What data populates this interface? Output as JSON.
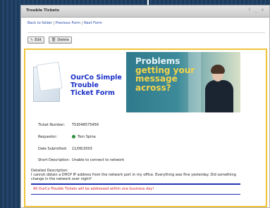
{
  "window": {
    "title": "Trouble Tickets",
    "controls": "? _ ×"
  },
  "breadcrumbs": {
    "back": "Back to folder",
    "previous": "Previous Form",
    "next": "Next Form",
    "separator": "|"
  },
  "toolbar": {
    "edit_label": "Edit",
    "delete_label": "Delete"
  },
  "logo": {
    "line1": "OurCo Simple",
    "line2": "Trouble",
    "line3": "Ticket Form"
  },
  "banner": {
    "line1": "Problems",
    "line2": "getting your",
    "line3": "message",
    "line4": "across?"
  },
  "ticket": {
    "number_label": "Ticket Number:",
    "number_value": "TS3048575456",
    "requestor_label": "Requestor:",
    "requestor_value": "Tom Spina",
    "date_label": "Date Submitted:",
    "date_value": "11/06/2003",
    "short_desc_label": "Short Description:",
    "short_desc_value": "Unable to connect to network",
    "detailed_desc_label": "Detailed Description:",
    "detailed_desc_value": "I cannot obtain a DHCP IP address from the network port in my office. Everything was fine yesterday. Did something change in the network over night?"
  },
  "notice": "All OurCo Trouble Tickets will be addressed within one business day!",
  "colors": {
    "link": "#2a4fa8",
    "form_border": "#f0c43a",
    "logo_text": "#1a30c8",
    "notice": "#d2202b",
    "rule": "#2232b0"
  }
}
